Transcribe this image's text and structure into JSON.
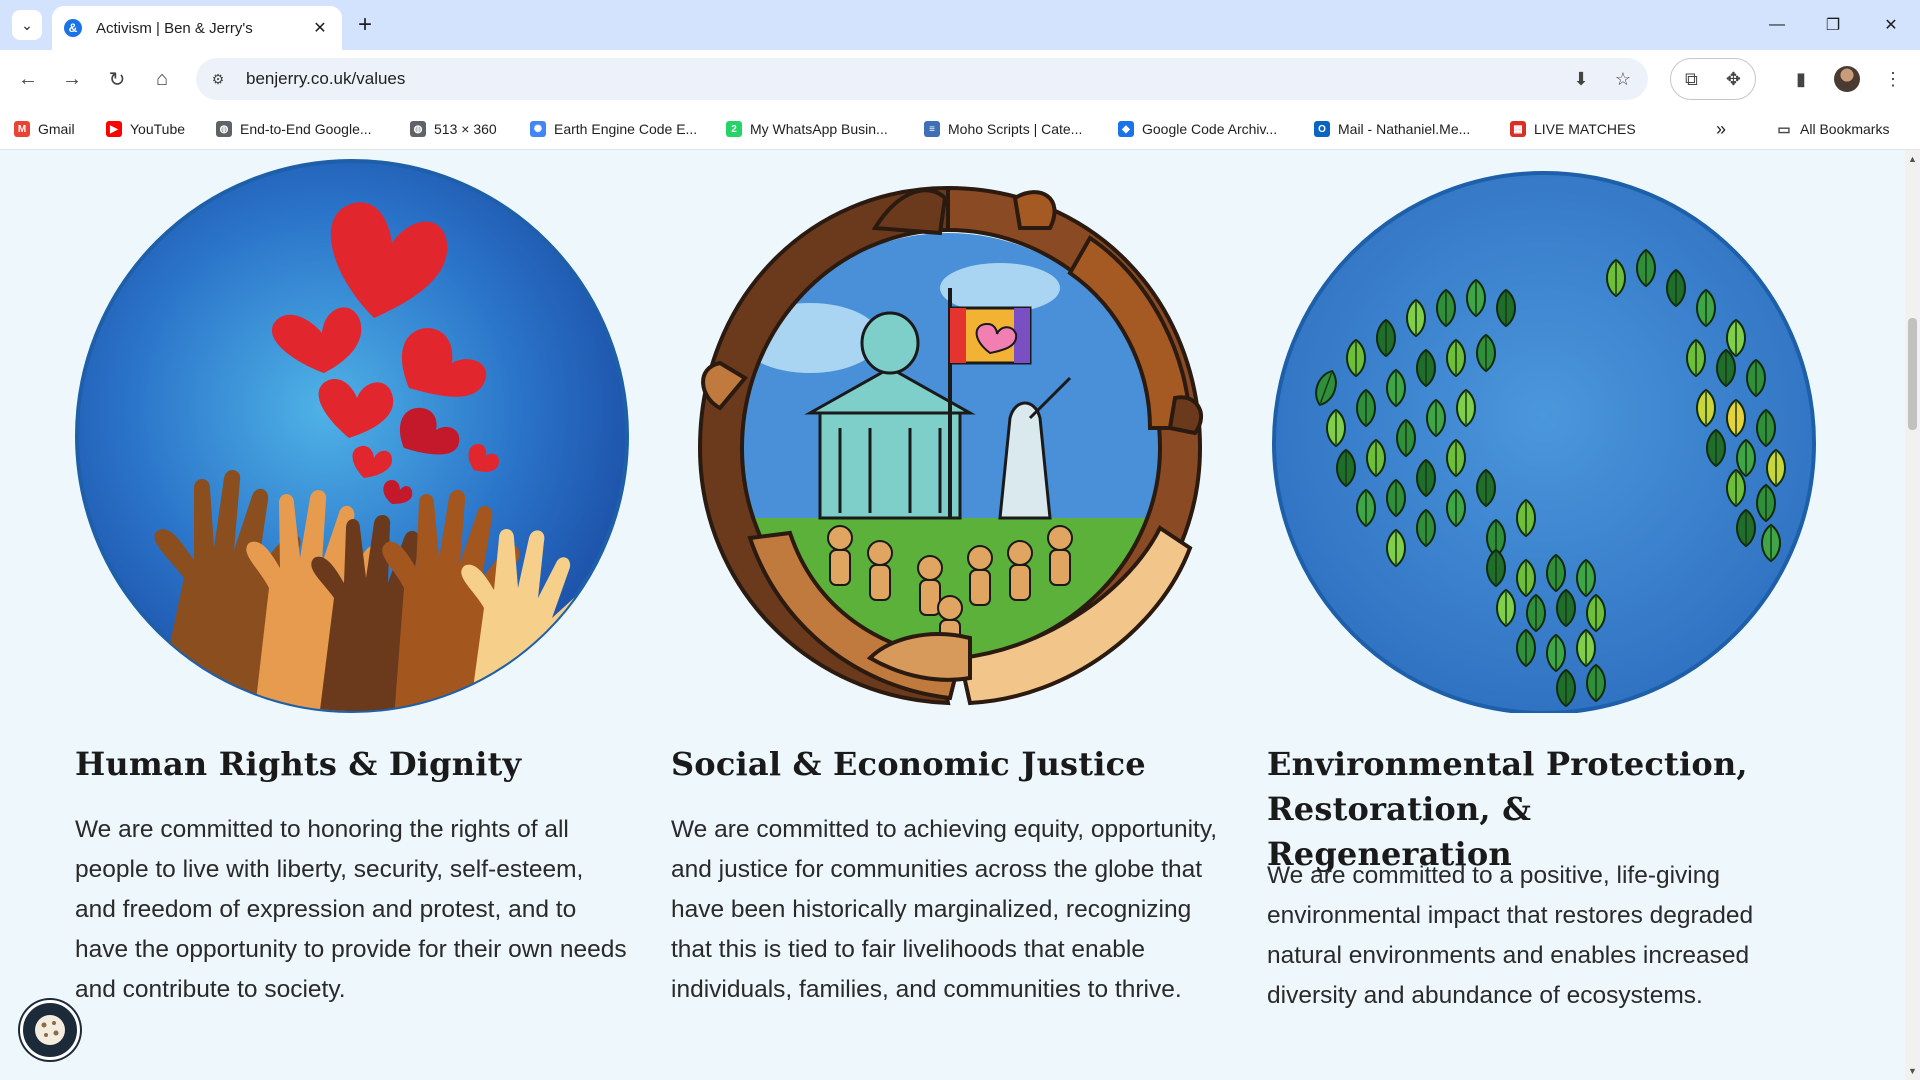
{
  "browser": {
    "tab_title": "Activism | Ben & Jerry's",
    "tab_favicon": "🔄",
    "url": "benjerry.co.uk/values",
    "new_tab": "+",
    "bookmarks": [
      {
        "label": "Gmail",
        "icon": "gmail-icon",
        "color": "#ea4335",
        "glyph": "M"
      },
      {
        "label": "YouTube",
        "icon": "youtube-icon",
        "color": "#ff0000",
        "glyph": "▶"
      },
      {
        "label": "End-to-End Google...",
        "icon": "globe-icon",
        "color": "#5f6368",
        "glyph": "◍"
      },
      {
        "label": "513 × 360",
        "icon": "globe-icon",
        "color": "#5f6368",
        "glyph": "◍"
      },
      {
        "label": "Earth Engine Code E...",
        "icon": "earth-engine-icon",
        "color": "#4285f4",
        "glyph": "✺"
      },
      {
        "label": "My WhatsApp Busin...",
        "icon": "whatsapp-icon",
        "color": "#25d366",
        "glyph": "2"
      },
      {
        "label": "Moho Scripts | Cate...",
        "icon": "list-icon",
        "color": "#3f6fb5",
        "glyph": "≡"
      },
      {
        "label": "Google Code Archiv...",
        "icon": "google-code-icon",
        "color": "#1a73e8",
        "glyph": "◆"
      },
      {
        "label": "Mail - Nathaniel.Me...",
        "icon": "outlook-icon",
        "color": "#0a64c2",
        "glyph": "O"
      },
      {
        "label": "LIVE MATCHES",
        "icon": "live-matches-icon",
        "color": "#d93025",
        "glyph": "▦"
      }
    ],
    "bookmarks_overflow": "»",
    "all_bookmarks": "All Bookmarks"
  },
  "sections": [
    {
      "heading": "Human Rights & Dignity",
      "body": "We are committed to honoring the rights of all people to live with liberty, security, self-esteem, and freedom of expression and protest, and to have the opportunity to provide for their own needs and contribute to society."
    },
    {
      "heading": "Social & Economic Justice",
      "body": "We are committed to achieving equity, opportunity, and justice for communities across the globe that have been historically marginalized, recognizing that this is tied to fair livelihoods that enable individuals, families, and communities to thrive."
    },
    {
      "heading": "Environmental Protection, Restoration, & Regeneration",
      "body": "We are committed to a positive, life-giving environmental impact that restores degraded natural environments and enables increased diversity and abundance of ecosystems."
    }
  ],
  "colors": {
    "page_bg": "#eef7fb",
    "heading": "#1a1a1a",
    "body": "#2a2a2a",
    "tabbar": "#d3e3fd"
  }
}
